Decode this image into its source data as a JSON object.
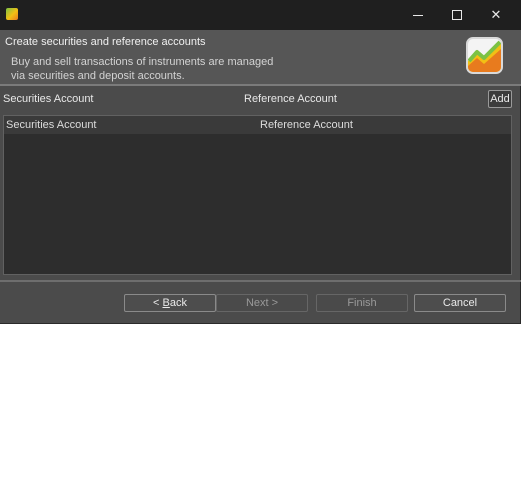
{
  "titlebar": {
    "title": "",
    "app_icon": "portfolio-performance-icon",
    "minimize_icon": "minimize-icon",
    "maximize_icon": "maximize-icon",
    "close_icon": "close-icon",
    "close_glyph": "✕"
  },
  "banner": {
    "title": "Create securities and reference accounts",
    "description_line1": "Buy and sell transactions of instruments are managed",
    "description_line2": "via securities and deposit accounts.",
    "logo_icon": "chart-growth-icon"
  },
  "form": {
    "securities_account_label": "Securities Account",
    "reference_account_label": "Reference Account",
    "add_label": "Add"
  },
  "table": {
    "columns": [
      "Securities Account",
      "Reference Account"
    ],
    "rows": []
  },
  "buttons": {
    "back_prefix": "< ",
    "back_mnemonic": "B",
    "back_rest": "ack",
    "next": "Next >",
    "finish": "Finish",
    "cancel": "Cancel"
  },
  "colors": {
    "window_bg": "#4b4b4b",
    "titlebar_bg": "#1f1f1f",
    "table_bg": "#2d2d2d",
    "logo_green": "#7cc243",
    "logo_orange": "#e87b1e",
    "logo_yellow": "#f2c014"
  }
}
